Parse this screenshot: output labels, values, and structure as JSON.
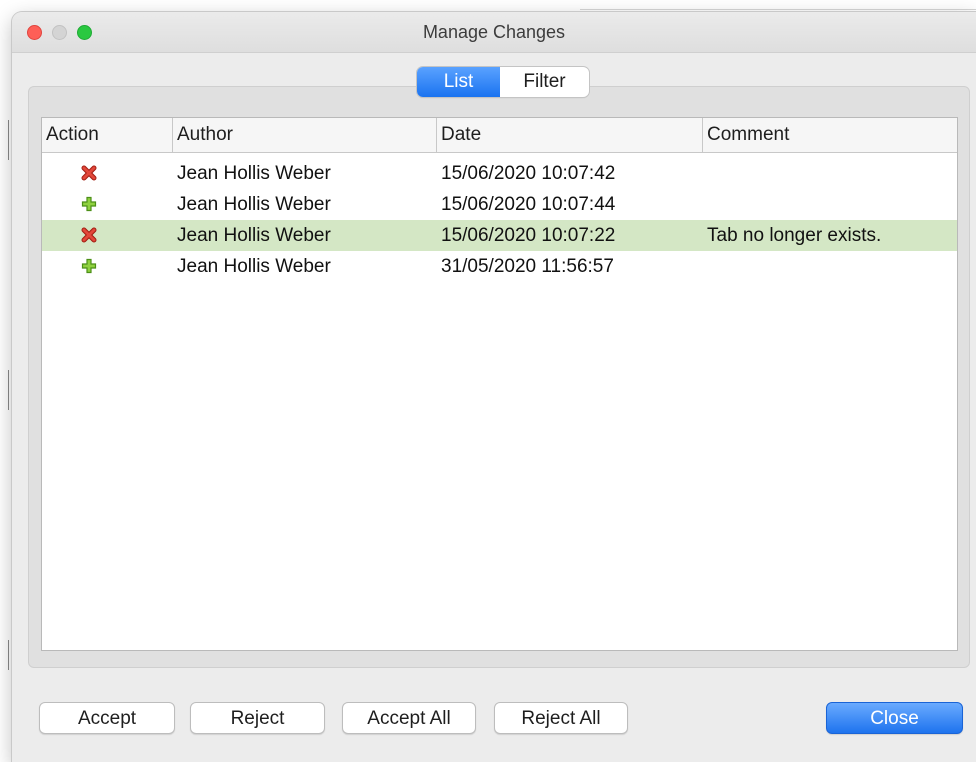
{
  "window": {
    "title": "Manage Changes"
  },
  "tabs": [
    {
      "label": "List",
      "active": true
    },
    {
      "label": "Filter",
      "active": false
    }
  ],
  "list": {
    "columns": [
      "Action",
      "Author",
      "Date",
      "Comment"
    ],
    "rows": [
      {
        "action_icon": "reject-x-icon",
        "author": "Jean Hollis Weber",
        "date": "15/06/2020 10:07:42",
        "comment": "",
        "selected": false
      },
      {
        "action_icon": "insert-plus-icon",
        "author": "Jean Hollis Weber",
        "date": "15/06/2020 10:07:44",
        "comment": "",
        "selected": false
      },
      {
        "action_icon": "reject-x-icon",
        "author": "Jean Hollis Weber",
        "date": "15/06/2020 10:07:22",
        "comment": "Tab no longer exists.",
        "selected": true
      },
      {
        "action_icon": "insert-plus-icon",
        "author": "Jean Hollis Weber",
        "date": "31/05/2020 11:56:57",
        "comment": "",
        "selected": false
      }
    ]
  },
  "buttons": {
    "accept": "Accept",
    "reject": "Reject",
    "accept_all": "Accept All",
    "reject_all": "Reject All",
    "close": "Close"
  },
  "colors": {
    "selected_row": "#d4e7c5",
    "accent": "#1e73ee",
    "delete_icon": "#d83a2a",
    "insert_icon": "#6fb82a"
  }
}
